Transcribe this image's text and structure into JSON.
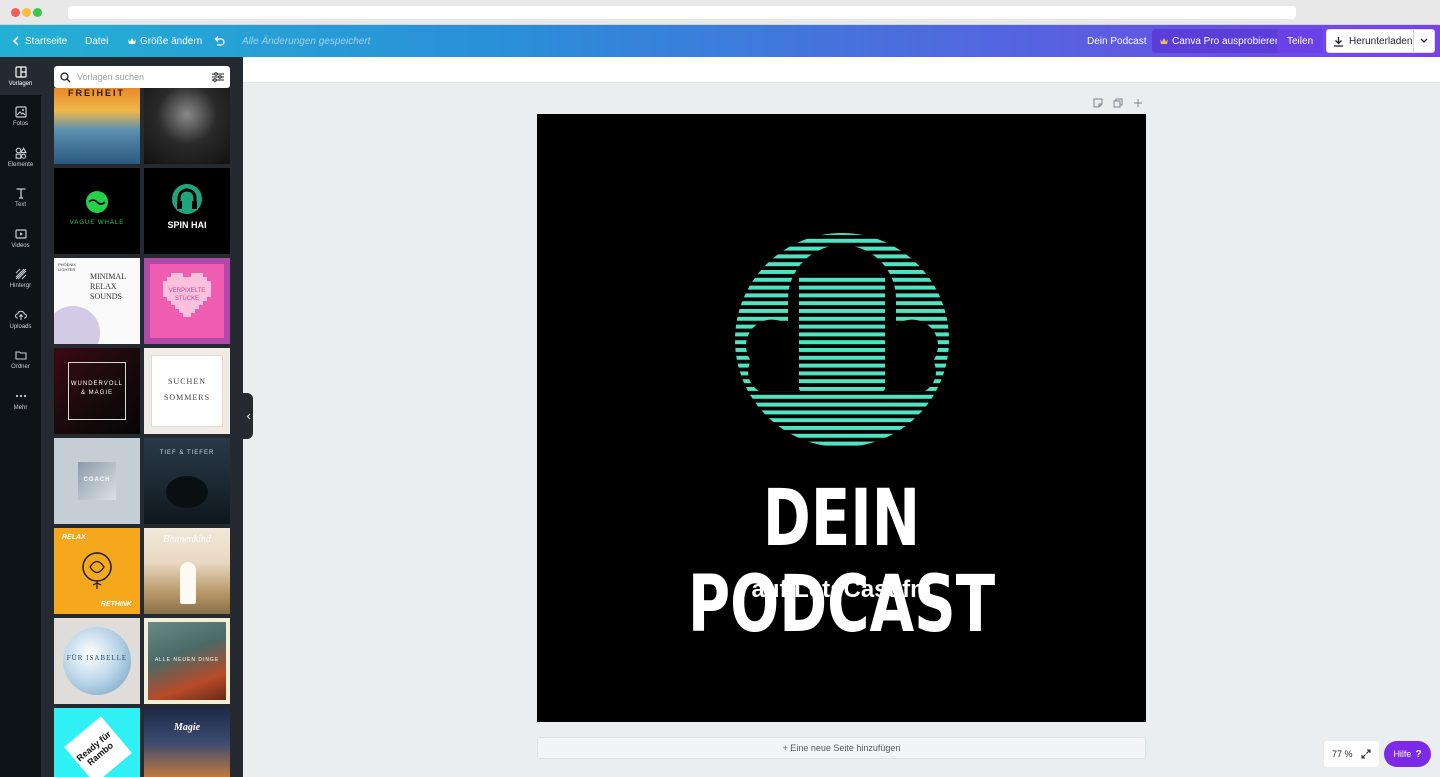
{
  "topbar": {
    "home_label": "Startseite",
    "file_label": "Datei",
    "resize_label": "Größe ändern",
    "saved_status": "Alle Änderungen gespeichert",
    "design_name": "Dein Podcast",
    "pro_label": "Canva Pro ausprobieren",
    "share_label": "Teilen",
    "download_label": "Herunterladen"
  },
  "rail": {
    "items": [
      {
        "label": "Vorlagen",
        "icon": "layout-icon"
      },
      {
        "label": "Fotos",
        "icon": "photo-icon"
      },
      {
        "label": "Elemente",
        "icon": "shapes-icon"
      },
      {
        "label": "Text",
        "icon": "text-icon"
      },
      {
        "label": "Videos",
        "icon": "video-icon"
      },
      {
        "label": "Hintergr",
        "icon": "background-icon"
      },
      {
        "label": "Uploads",
        "icon": "upload-icon"
      },
      {
        "label": "Ordner",
        "icon": "folder-icon"
      },
      {
        "label": "Mehr",
        "icon": "more-icon"
      }
    ]
  },
  "panel": {
    "search_placeholder": "Vorlagen suchen",
    "templates": [
      {
        "text": "FREIHEIT"
      },
      {
        "text": ""
      },
      {
        "text": "VAGUE WHALE"
      },
      {
        "text": "SPIN HAI"
      },
      {
        "text": "MINIMAL RELAX SOUNDS",
        "small": "PHOENIX LIGHTER"
      },
      {
        "text": "VERPIXELTE STÜCKE"
      },
      {
        "text": "WUNDERVOLL & MAGIE"
      },
      {
        "text": "SUCHEN",
        "sub": "SOMMERS"
      },
      {
        "text": "COACH"
      },
      {
        "text": "TIEF & TIEFER"
      },
      {
        "text": "RELAX",
        "sub": "RETHINK"
      },
      {
        "text": "Blumenkind"
      },
      {
        "text": "FÜR ISABELLE"
      },
      {
        "text": "ALLE NEUEN DINGE"
      },
      {
        "text": "Ready für Rambo"
      },
      {
        "text": "Magie"
      }
    ]
  },
  "canvas": {
    "title": "DEIN PODCAST",
    "subtitle": "auf LetsCast.fm",
    "accent_color": "#4fe3c1"
  },
  "footer": {
    "add_page_label": "+ Eine neue Seite hinzufügen",
    "zoom_label": "77 %",
    "help_label": "Hilfe",
    "help_glyph": "?"
  }
}
